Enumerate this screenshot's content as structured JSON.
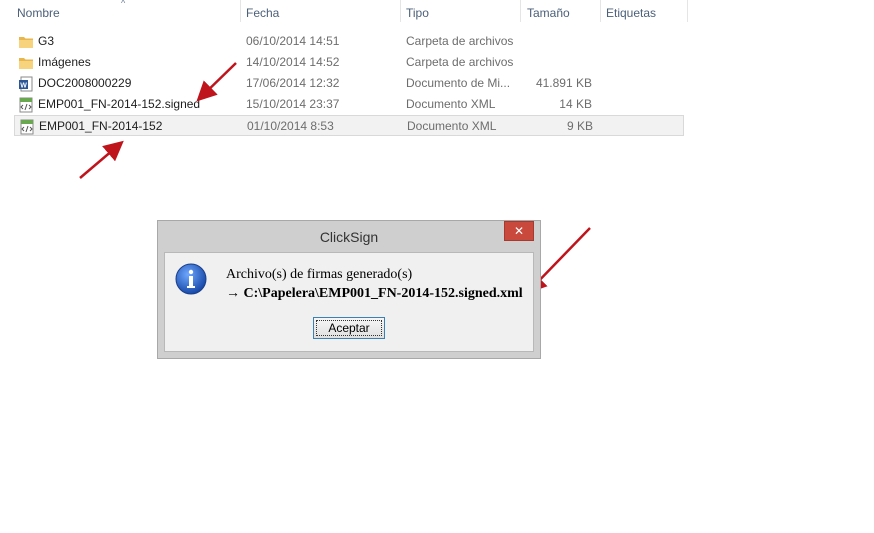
{
  "header": {
    "columns": [
      "Nombre",
      "Fecha",
      "Tipo",
      "Tamaño",
      "Etiquetas"
    ],
    "sort_indicator": "^"
  },
  "files": [
    {
      "name": "G3",
      "date": "06/10/2014 14:51",
      "type": "Carpeta de archivos",
      "size": "",
      "icon": "folder-icon"
    },
    {
      "name": "Imágenes",
      "date": "14/10/2014 14:52",
      "type": "Carpeta de archivos",
      "size": "",
      "icon": "folder-icon"
    },
    {
      "name": "DOC2008000229",
      "date": "17/06/2014 12:32",
      "type": "Documento de Mi...",
      "size": "41.891 KB",
      "icon": "word-document-icon"
    },
    {
      "name": "EMP001_FN-2014-152.signed",
      "date": "15/10/2014 23:37",
      "type": "Documento XML",
      "size": "14 KB",
      "icon": "xml-document-icon"
    },
    {
      "name": "EMP001_FN-2014-152",
      "date": "01/10/2014 8:53",
      "type": "Documento XML",
      "size": "9 KB",
      "icon": "xml-document-icon",
      "selected": true
    }
  ],
  "dialog": {
    "title": "ClickSign",
    "close_label": "✕",
    "message_line1": "Archivo(s) de firmas generado(s)",
    "message_line2": "→ C:\\Papelera\\EMP001_FN-2014-152.signed.xml",
    "ok_label": "Aceptar",
    "icon": "info-icon"
  },
  "annotation_color": "#c0141c"
}
